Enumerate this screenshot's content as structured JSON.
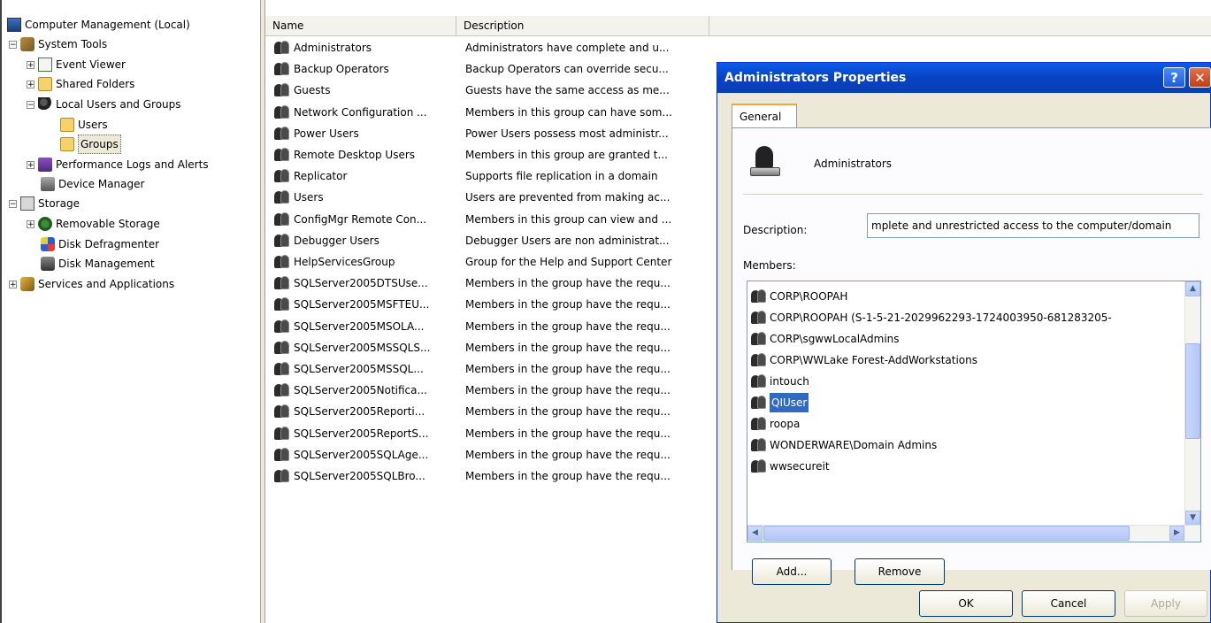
{
  "tree": {
    "items": [
      {
        "label": "Computer Management (Local)",
        "icon": "computer-icon"
      },
      {
        "label": "System Tools",
        "icon": "tools-icon",
        "expander": "−"
      },
      {
        "label": "Event Viewer",
        "icon": "event-viewer-icon",
        "expander": "+"
      },
      {
        "label": "Shared Folders",
        "icon": "shared-folders-icon",
        "expander": "+"
      },
      {
        "label": "Local Users and Groups",
        "icon": "users-groups-icon",
        "expander": "−"
      },
      {
        "label": "Users",
        "icon": "folder-icon"
      },
      {
        "label": "Groups",
        "icon": "folder-icon",
        "selected": true
      },
      {
        "label": "Performance Logs and Alerts",
        "icon": "performance-icon",
        "expander": "+"
      },
      {
        "label": "Device Manager",
        "icon": "device-manager-icon"
      },
      {
        "label": "Storage",
        "icon": "storage-icon",
        "expander": "−"
      },
      {
        "label": "Removable Storage",
        "icon": "removable-storage-icon",
        "expander": "+"
      },
      {
        "label": "Disk Defragmenter",
        "icon": "defrag-icon"
      },
      {
        "label": "Disk Management",
        "icon": "disk-management-icon"
      },
      {
        "label": "Services and Applications",
        "icon": "services-icon",
        "expander": "+"
      }
    ]
  },
  "list": {
    "columns": [
      "Name",
      "Description"
    ],
    "rows": [
      {
        "name": "Administrators",
        "desc": "Administrators have complete and u..."
      },
      {
        "name": "Backup Operators",
        "desc": "Backup Operators can override secu..."
      },
      {
        "name": "Guests",
        "desc": "Guests have the same access as me..."
      },
      {
        "name": "Network Configuration ...",
        "desc": "Members in this group can have som..."
      },
      {
        "name": "Power Users",
        "desc": "Power Users possess most administr..."
      },
      {
        "name": "Remote Desktop Users",
        "desc": "Members in this group are granted t..."
      },
      {
        "name": "Replicator",
        "desc": "Supports file replication in a domain"
      },
      {
        "name": "Users",
        "desc": "Users are prevented from making ac..."
      },
      {
        "name": "ConfigMgr Remote Con...",
        "desc": "Members in this group can view and ..."
      },
      {
        "name": "Debugger Users",
        "desc": "Debugger Users are non administrat..."
      },
      {
        "name": "HelpServicesGroup",
        "desc": "Group for the Help and Support Center"
      },
      {
        "name": "SQLServer2005DTSUse...",
        "desc": "Members in the group have the requ..."
      },
      {
        "name": "SQLServer2005MSFTEU...",
        "desc": "Members in the group have the requ..."
      },
      {
        "name": "SQLServer2005MSOLA...",
        "desc": "Members in the group have the requ..."
      },
      {
        "name": "SQLServer2005MSSQLS...",
        "desc": "Members in the group have the requ..."
      },
      {
        "name": "SQLServer2005MSSQL...",
        "desc": "Members in the group have the requ..."
      },
      {
        "name": "SQLServer2005Notifica...",
        "desc": "Members in the group have the requ..."
      },
      {
        "name": "SQLServer2005Reporti...",
        "desc": "Members in the group have the requ..."
      },
      {
        "name": "SQLServer2005ReportS...",
        "desc": "Members in the group have the requ..."
      },
      {
        "name": "SQLServer2005SQLAge...",
        "desc": "Members in the group have the requ..."
      },
      {
        "name": "SQLServer2005SQLBro...",
        "desc": "Members in the group have the requ..."
      }
    ]
  },
  "dialog": {
    "title": "Administrators Properties",
    "help_glyph": "?",
    "close_glyph": "✕",
    "tab": "General",
    "group_name": "Administrators",
    "description_label": "Description:",
    "description_value": "mplete and unrestricted access to the computer/domain",
    "members_label": "Members:",
    "members": [
      {
        "name": "CORP\\ROOPAH",
        "selected": false
      },
      {
        "name": "CORP\\ROOPAH (S-1-5-21-2029962293-1724003950-681283205-",
        "selected": false
      },
      {
        "name": "CORP\\sgwwLocalAdmins",
        "selected": false
      },
      {
        "name": "CORP\\WWLake Forest-AddWorkstations",
        "selected": false
      },
      {
        "name": "intouch",
        "selected": false
      },
      {
        "name": "QIUser",
        "selected": true
      },
      {
        "name": "roopa",
        "selected": false
      },
      {
        "name": "WONDERWARE\\Domain Admins",
        "selected": false
      },
      {
        "name": "wwsecureit",
        "selected": false
      }
    ],
    "scroll": {
      "up": "▲",
      "down": "▼",
      "left": "◀",
      "right": "▶"
    },
    "buttons": {
      "add": "Add...",
      "remove": "Remove",
      "ok": "OK",
      "cancel": "Cancel",
      "apply": "Apply"
    }
  }
}
